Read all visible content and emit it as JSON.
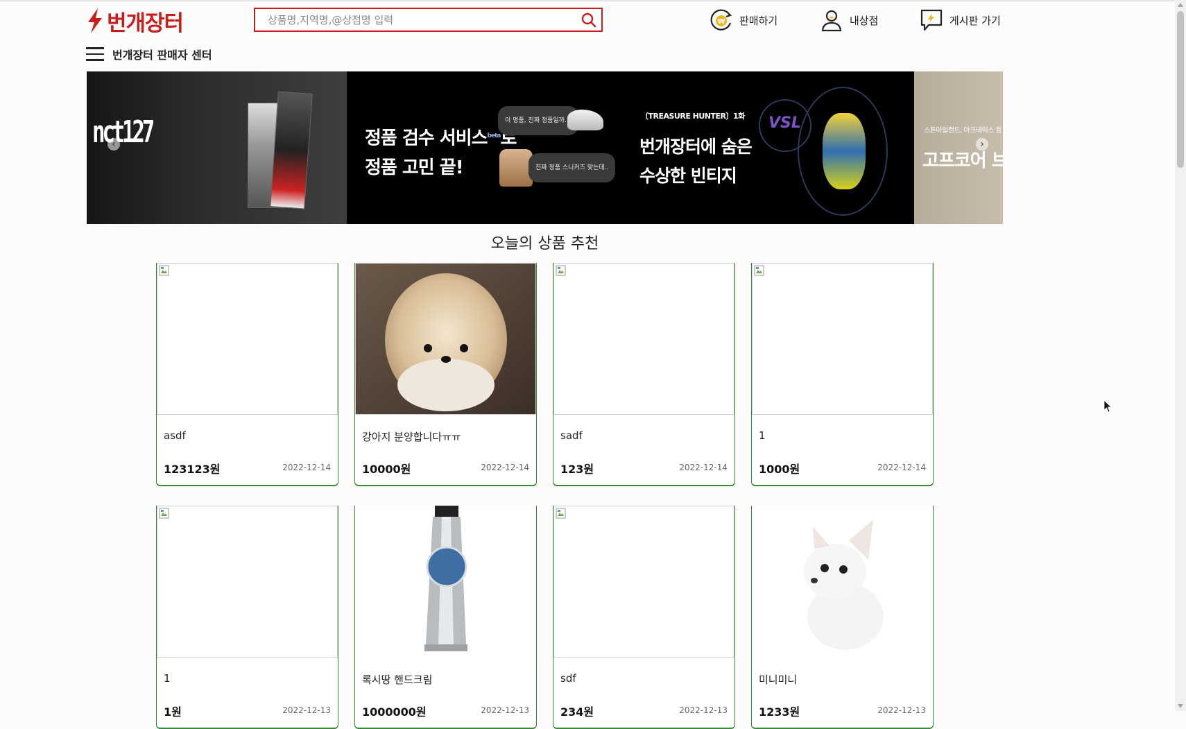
{
  "header": {
    "logo_text": "번개장터",
    "search_placeholder": "상품명,지역명,@상점명 입력",
    "nav": [
      {
        "label": "판매하기",
        "icon": "won-sell-icon"
      },
      {
        "label": "내상점",
        "icon": "user-icon"
      },
      {
        "label": "게시판 가기",
        "icon": "board-chat-icon"
      }
    ],
    "seller_center_label": "번개장터 판매자 센터"
  },
  "banner": {
    "slides": [
      {
        "logo_text": "nct127"
      },
      {
        "line1": "정품 검수 서비스",
        "beta": "beta",
        "line1_suffix": "로",
        "line2": "정품 고민 끝!",
        "bubble1": "이 명품, 진짜 정품일까..?",
        "bubble2": "진짜 정품 스니커즈 맞는데.."
      },
      {
        "small": "〔TREASURE HUNTER〕1화",
        "line1": "번개장터에 숨은",
        "line2": "수상한 빈티지",
        "brand": "VSL"
      },
      {
        "small": "스톤아일랜드, 아크테릭스 등",
        "big": "고프코어 브랜드"
      }
    ]
  },
  "section": {
    "title": "오늘의 상품 추천"
  },
  "products": [
    {
      "name": "asdf",
      "price": "123123원",
      "date": "2022-12-14",
      "image": "broken"
    },
    {
      "name": "강아지 분양합니다ㅠㅠ",
      "price": "10000원",
      "date": "2022-12-14",
      "image": "pomeranian"
    },
    {
      "name": "sadf",
      "price": "123원",
      "date": "2022-12-14",
      "image": "broken"
    },
    {
      "name": "1",
      "price": "1000원",
      "date": "2022-12-14",
      "image": "broken"
    },
    {
      "name": "1",
      "price": "1원",
      "date": "2022-12-13",
      "image": "broken"
    },
    {
      "name": "록시땅 핸드크림",
      "price": "1000000원",
      "date": "2022-12-13",
      "image": "hand-cream"
    },
    {
      "name": "sdf",
      "price": "234원",
      "date": "2022-12-13",
      "image": "broken"
    },
    {
      "name": "미니미니",
      "price": "1233원",
      "date": "2022-12-13",
      "image": "chihuahua"
    }
  ],
  "colors": {
    "brand": "#c71d1d",
    "card_accent": "#2f8a2f"
  }
}
